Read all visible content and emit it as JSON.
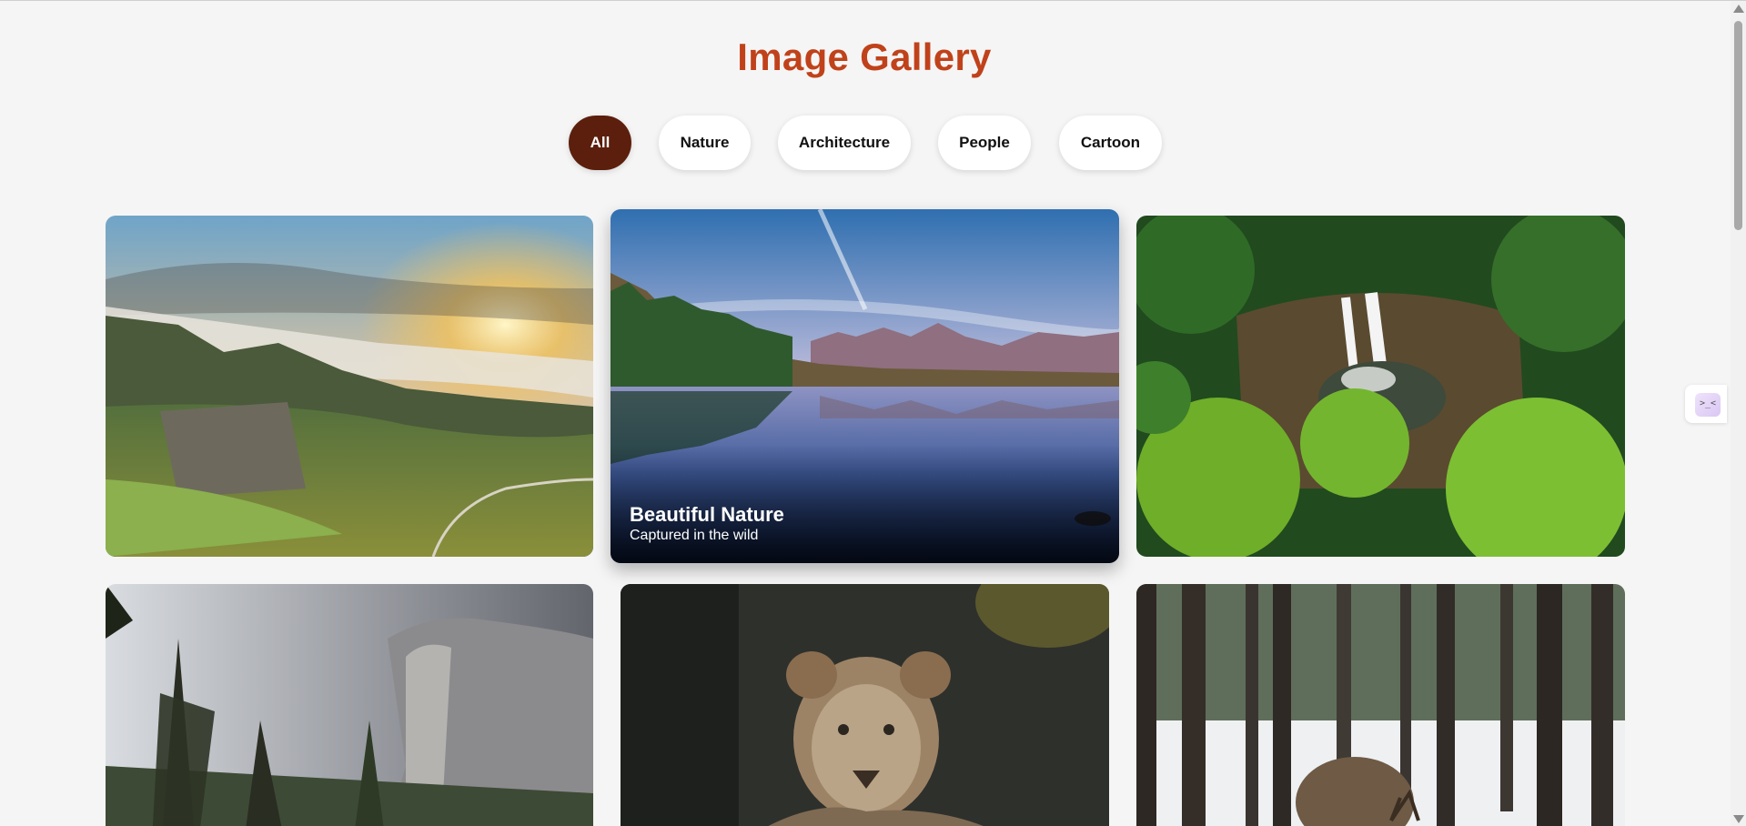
{
  "header": {
    "title": "Image Gallery"
  },
  "filters": [
    {
      "label": "All",
      "active": true
    },
    {
      "label": "Nature",
      "active": false
    },
    {
      "label": "Architecture",
      "active": false
    },
    {
      "label": "People",
      "active": false
    },
    {
      "label": "Cartoon",
      "active": false
    }
  ],
  "gallery": {
    "items": [
      {
        "subject": "misty green valley at sunrise"
      },
      {
        "subject": "mountain lake reflection",
        "caption": {
          "title": "Beautiful Nature",
          "subtitle": "Captured in the wild"
        }
      },
      {
        "subject": "waterfall in jungle aerial view"
      },
      {
        "subject": "granite cliff with pine trees"
      },
      {
        "subject": "young lion portrait"
      },
      {
        "subject": "deer in snowy forest"
      }
    ]
  },
  "colors": {
    "accent": "#c0421a",
    "active_filter": "#5c1f0d",
    "background": "#f5f5f5"
  },
  "extension": {
    "icon": "extension-icon",
    "glyph": ">_<"
  }
}
